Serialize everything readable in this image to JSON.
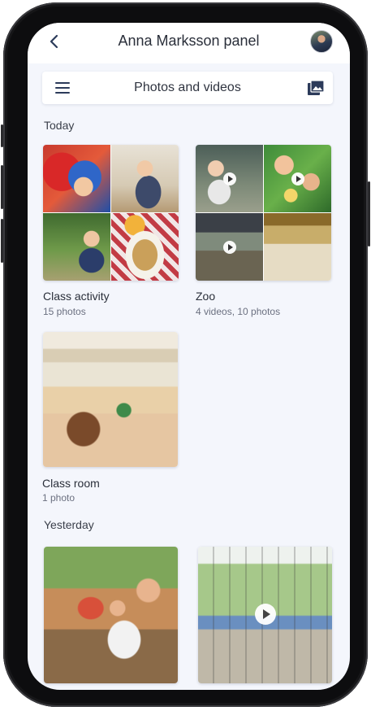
{
  "header": {
    "title": "Anna Marksson panel"
  },
  "nav": {
    "title": "Photos and videos"
  },
  "sections": [
    {
      "label": "Today"
    },
    {
      "label": "Yesterday"
    }
  ],
  "albums": [
    {
      "name": "Class activity",
      "meta": "15 photos"
    },
    {
      "name": "Zoo",
      "meta": "4 videos, 10 photos"
    },
    {
      "name": "Class room",
      "meta": "1 photo"
    }
  ],
  "icons": {
    "back": "chevron-left-icon",
    "menu": "hamburger-menu-icon",
    "gallery": "photo-library-icon",
    "play": "play-icon"
  },
  "colors": {
    "accent": "#2c3b5a",
    "background": "#f4f6fc"
  }
}
